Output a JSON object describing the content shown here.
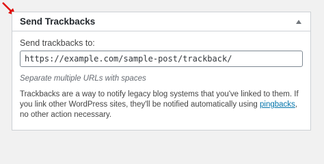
{
  "colors": {
    "accent": "#e10600",
    "link": "#0073aa",
    "border": "#ccd0d4",
    "background": "#f1f1f1"
  },
  "pointer": {
    "icon": "red-arrow-icon"
  },
  "panel": {
    "title": "Send Trackbacks",
    "toggle_icon": "triangle-up-icon",
    "field_label": "Send trackbacks to:",
    "input_value": "https://example.com/sample-post/trackback/",
    "hint": "Separate multiple URLs with spaces",
    "description_before": "Trackbacks are a way to notify legacy blog systems that you've linked to them. If you link other WordPress sites, they'll be notified automatically using ",
    "description_link": "pingbacks",
    "description_after": ", no other action necessary."
  }
}
